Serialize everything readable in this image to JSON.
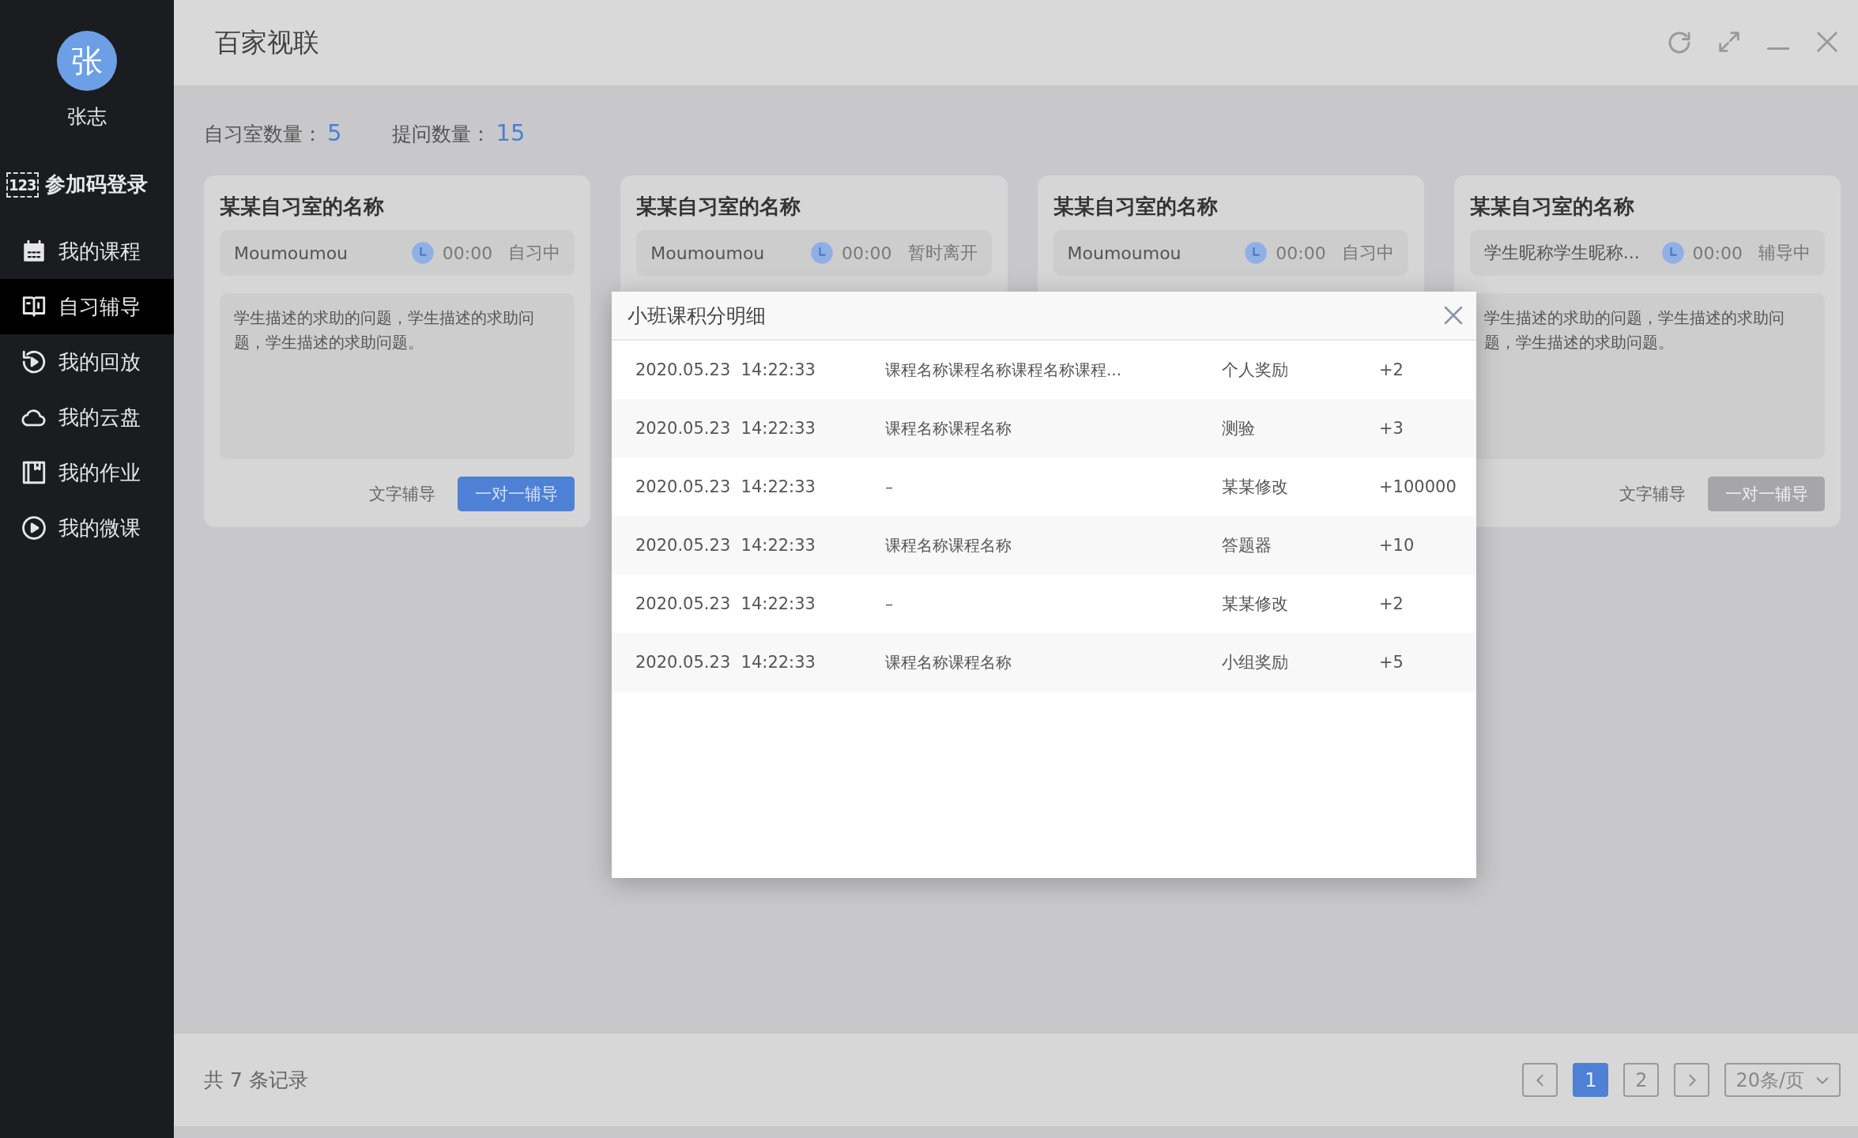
{
  "sidebar": {
    "avatar": "张",
    "name": "张志",
    "code_login": {
      "badge": "123",
      "label": "参加码登录"
    },
    "items": [
      {
        "label": "我的课程",
        "selected": false
      },
      {
        "label": "自习辅导",
        "selected": true
      },
      {
        "label": "我的回放",
        "selected": false
      },
      {
        "label": "我的云盘",
        "selected": false
      },
      {
        "label": "我的作业",
        "selected": false
      },
      {
        "label": "我的微课",
        "selected": false
      }
    ]
  },
  "header": {
    "title": "百家视联"
  },
  "stats": [
    {
      "label": "自习室数量：",
      "value": "5"
    },
    {
      "label": "提问数量：",
      "value": "15"
    }
  ],
  "cards": [
    {
      "title": "某某自习室的名称",
      "student": "Moumoumou",
      "time": "00:00",
      "status": "自习中",
      "description": "学生描述的求助的问题，学生描述的求助问题，学生描述的求助问题。",
      "actions": [
        {
          "label": "文字辅导",
          "kind": "text",
          "disabled": false
        },
        {
          "label": "一对一辅导",
          "kind": "primary",
          "disabled": false
        }
      ]
    },
    {
      "title": "某某自习室的名称",
      "student": "Moumoumou",
      "time": "00:00",
      "status": "暂时离开"
    },
    {
      "title": "某某自习室的名称",
      "student": "Moumoumou",
      "time": "00:00",
      "status": "自习中"
    },
    {
      "title": "某某自习室的名称",
      "student": "学生昵称学生昵称...",
      "time": "00:00",
      "status": "辅导中",
      "description": "学生描述的求助的问题，学生描述的求助问题，学生描述的求助问题。",
      "actions": [
        {
          "label": "文字辅导",
          "kind": "text",
          "disabled": false
        },
        {
          "label": "一对一辅导",
          "kind": "primary",
          "disabled": true
        }
      ]
    }
  ],
  "footer": {
    "total": "共 7 条记录",
    "pages": [
      {
        "label": "1",
        "selected": true
      },
      {
        "label": "2",
        "selected": false
      }
    ],
    "page_size": "20条/页"
  },
  "modal": {
    "title": "小班课积分明细",
    "rows": [
      {
        "datetime": "2020.05.23  14:22:33",
        "course": "课程名称课程名称课程名称课程...",
        "type": "个人奖励",
        "points": "+2"
      },
      {
        "datetime": "2020.05.23  14:22:33",
        "course": "课程名称课程名称",
        "type": "测验",
        "points": "+3"
      },
      {
        "datetime": "2020.05.23  14:22:33",
        "course": "–",
        "type": "某某修改",
        "points": "+100000"
      },
      {
        "datetime": "2020.05.23  14:22:33",
        "course": "课程名称课程名称",
        "type": "答题器",
        "points": "+10"
      },
      {
        "datetime": "2020.05.23  14:22:33",
        "course": "–",
        "type": "某某修改",
        "points": "+2"
      },
      {
        "datetime": "2020.05.23  14:22:33",
        "course": "课程名称课程名称",
        "type": "小组奖励",
        "points": "+5"
      }
    ]
  }
}
